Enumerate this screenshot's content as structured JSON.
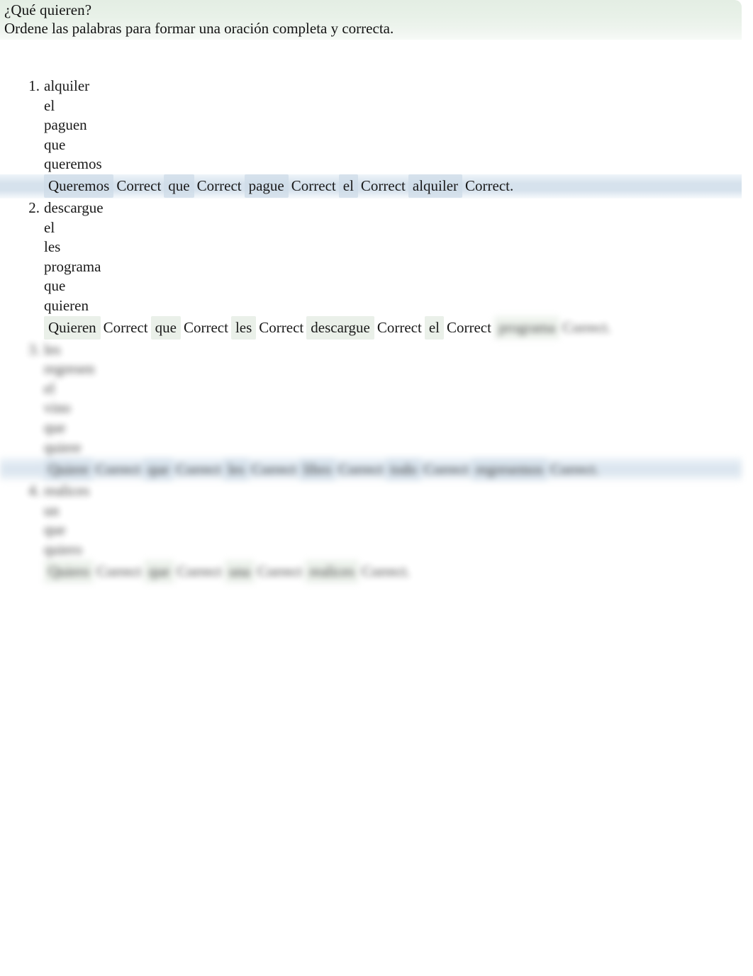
{
  "header": {
    "title": "¿Qué quieren?",
    "instructions": "Ordene las palabras para formar una oración completa y correcta."
  },
  "correct_label": "Correct",
  "exercises": [
    {
      "number": "1.",
      "words": [
        "alquiler",
        "el",
        "paguen",
        "que",
        "queremos"
      ],
      "answer": {
        "tokens": [
          "Queremos",
          "Correct",
          "que",
          "Correct",
          "pague",
          "Correct",
          "el",
          "Correct",
          "alquiler",
          "Correct."
        ],
        "legible_through": 10,
        "band": "blue"
      }
    },
    {
      "number": "2.",
      "words": [
        "descargue",
        "el",
        "les",
        "programa",
        "que",
        "quieren"
      ],
      "answer": {
        "tokens": [
          "Quieren",
          "Correct",
          "que",
          "Correct",
          "les",
          "Correct",
          "descargue",
          "Correct",
          "el",
          "Correct",
          "programa",
          "Correct."
        ],
        "legible_through": 10,
        "band": "none"
      }
    },
    {
      "number": "3.",
      "words": [
        "les",
        "regresen",
        "el",
        "vino",
        "que",
        "quiere"
      ],
      "answer": {
        "tokens": [
          "Quiere",
          "Correct",
          "que",
          "Correct",
          "les",
          "Correct",
          "libro",
          "Correct",
          "todo",
          "Correct",
          "regresemos",
          "Correct."
        ],
        "legible_through": 0,
        "band": "blue"
      }
    },
    {
      "number": "4.",
      "words": [
        "realices",
        "un",
        "que",
        "quiero"
      ],
      "answer": {
        "tokens": [
          "Quiero",
          "Correct",
          "que",
          "Correct",
          "una",
          "Correct",
          "realices",
          "Correct."
        ],
        "legible_through": 0,
        "band": "none"
      }
    }
  ]
}
